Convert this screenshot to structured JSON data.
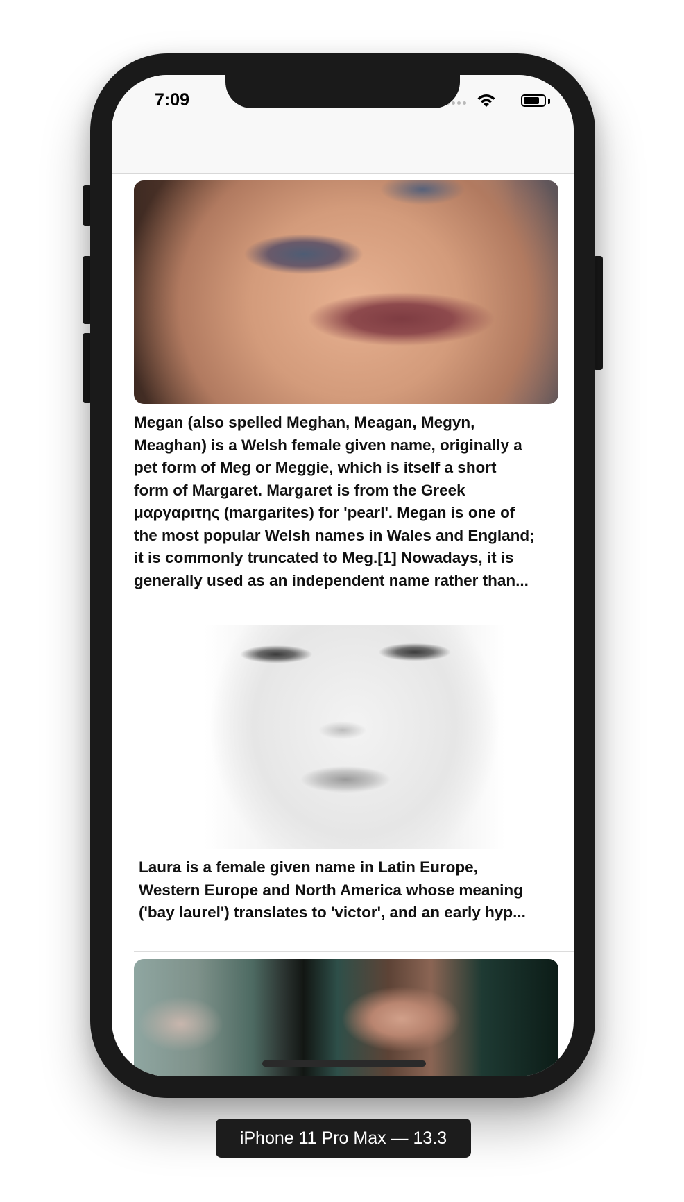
{
  "status_bar": {
    "time": "7:09",
    "icons": [
      "signal-icon",
      "wifi-icon",
      "battery-icon"
    ]
  },
  "nav_bar": {
    "title": ""
  },
  "feed": {
    "items": [
      {
        "image": "portrait-photo",
        "description_lines": [
          "Megan (also spelled Meghan, Meagan, Megyn,",
          "Meaghan) is a Welsh female given name, originally a",
          "pet form of Meg or Meggie, which is itself a short",
          "form of Margaret. Margaret is from the Greek",
          "μαργαριτης (margarites) for 'pearl'. Megan is one of",
          "the most popular Welsh names in Wales and England;",
          "it is commonly truncated to Meg.[1] Nowadays, it is",
          "generally used as an independent name rather than..."
        ]
      },
      {
        "image": "portrait-photo",
        "description_lines": [
          "Laura is a female given name in Latin Europe,",
          "Western Europe and North America whose meaning",
          "('bay laurel') translates to 'victor', and an early hyp..."
        ]
      },
      {
        "image": "portrait-photo",
        "description_lines": []
      }
    ]
  },
  "device_label": "iPhone 11 Pro Max — 13.3",
  "colors": {
    "device_frame": "#1a1a1a",
    "nav_bar_background": "#f8f8f8",
    "text": "#111111"
  }
}
